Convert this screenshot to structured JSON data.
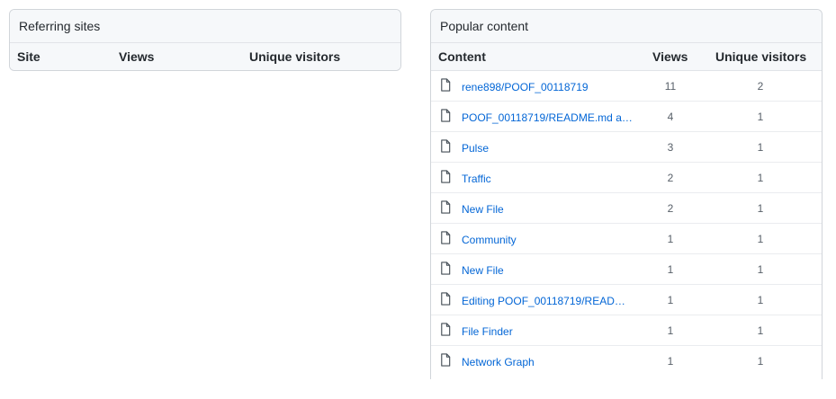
{
  "referring": {
    "title": "Referring sites",
    "columns": {
      "site": "Site",
      "views": "Views",
      "unique": "Unique visitors"
    }
  },
  "popular": {
    "title": "Popular content",
    "columns": {
      "content": "Content",
      "views": "Views",
      "unique": "Unique visitors"
    },
    "rows": [
      {
        "label": "rene898/POOF_00118719",
        "views": "11",
        "unique": "2",
        "icon": "file-icon"
      },
      {
        "label": "POOF_00118719/README.md at ...",
        "views": "4",
        "unique": "1",
        "icon": "file-icon"
      },
      {
        "label": "Pulse",
        "views": "3",
        "unique": "1",
        "icon": "file-icon"
      },
      {
        "label": "Traffic",
        "views": "2",
        "unique": "1",
        "icon": "file-icon"
      },
      {
        "label": "New File",
        "views": "2",
        "unique": "1",
        "icon": "file-icon"
      },
      {
        "label": "Community",
        "views": "1",
        "unique": "1",
        "icon": "file-icon"
      },
      {
        "label": "New File",
        "views": "1",
        "unique": "1",
        "icon": "file-icon"
      },
      {
        "label": "Editing POOF_00118719/README....",
        "views": "1",
        "unique": "1",
        "icon": "file-icon"
      },
      {
        "label": "File Finder",
        "views": "1",
        "unique": "1",
        "icon": "file-icon"
      },
      {
        "label": "Network Graph",
        "views": "1",
        "unique": "1",
        "icon": "file-icon"
      }
    ]
  },
  "colors": {
    "link": "#0366d6",
    "header_bg": "#f6f8fa",
    "border": "#d1d5da"
  }
}
